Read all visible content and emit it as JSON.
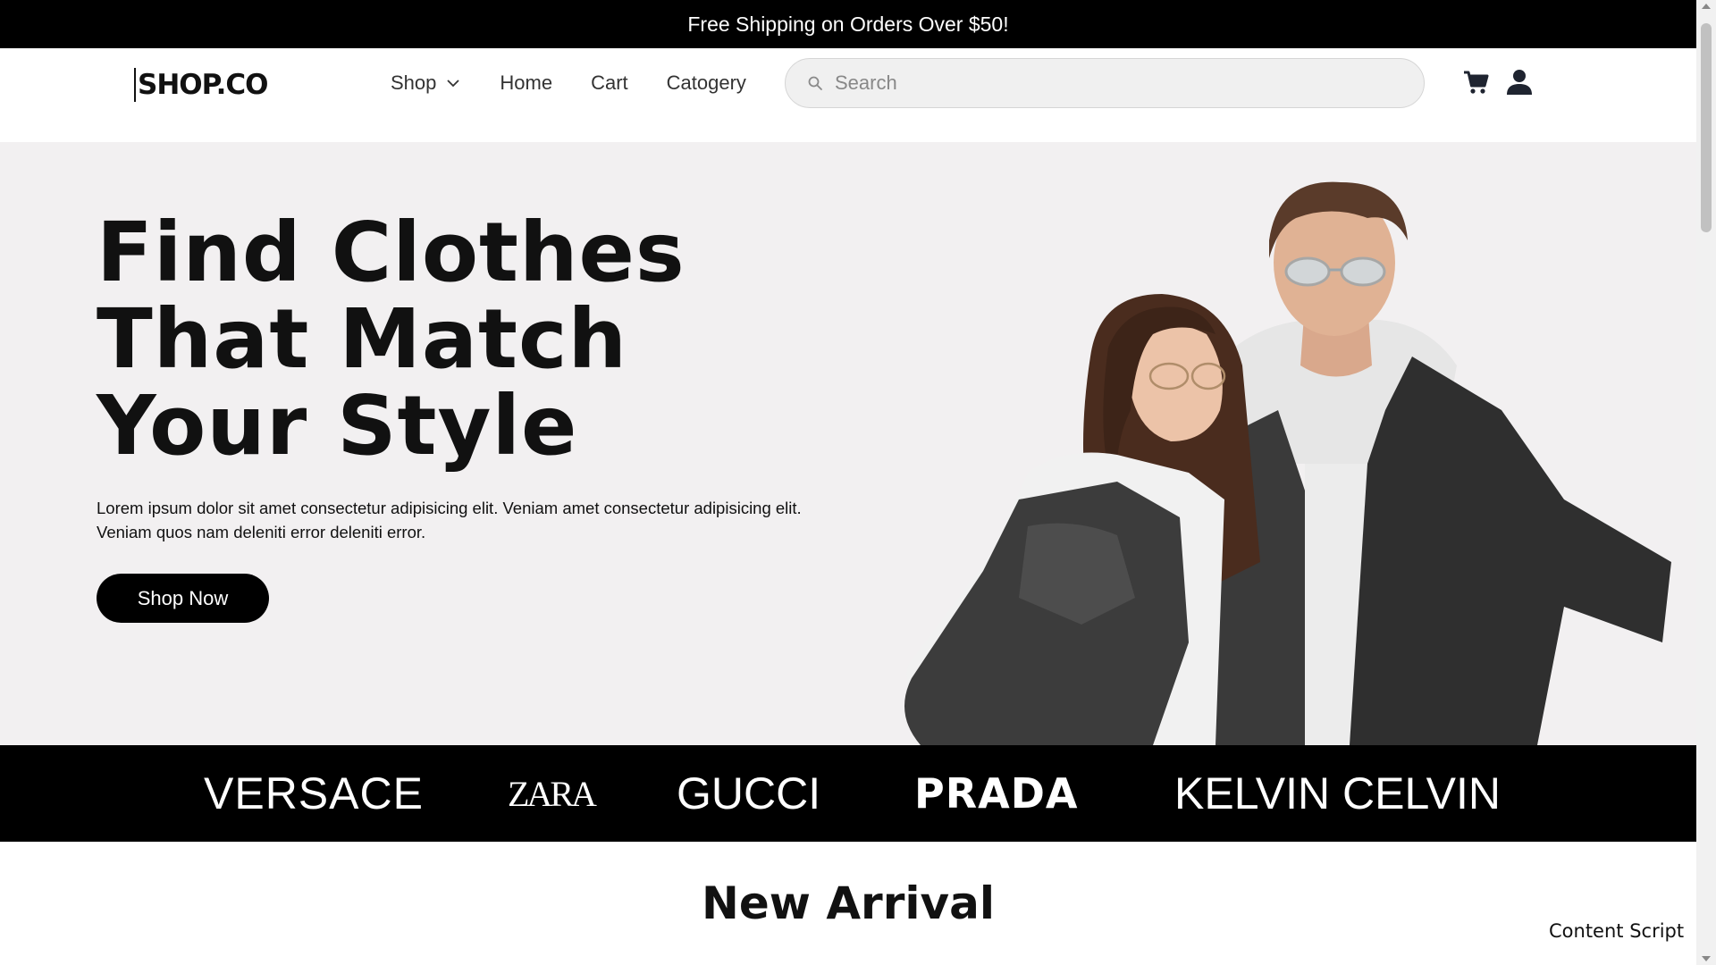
{
  "announcement": {
    "text": "Free Shipping on Orders Over $50!"
  },
  "header": {
    "logo": "SHOP.CO",
    "nav": [
      {
        "label": "Shop",
        "icon": "chevron-down-icon"
      },
      {
        "label": "Home"
      },
      {
        "label": "Cart"
      },
      {
        "label": "Catogery"
      }
    ],
    "search": {
      "placeholder": "Search",
      "value": "",
      "icon": "search-icon"
    },
    "icons": [
      "cart-icon",
      "user-icon"
    ]
  },
  "hero": {
    "title_lines": [
      "Find Clothes",
      "That Match",
      "Your Style"
    ],
    "description": "Lorem ipsum dolor sit amet consectetur adipisicing elit. Veniam amet consectetur adipisicing elit. Veniam quos nam deleniti error deleniti error.",
    "cta_label": "Shop Now",
    "background": "#f2f0f1"
  },
  "brands": [
    "VERSACE",
    "ZARA",
    "GUCCI",
    "PRADA",
    "KELVIN CELVIN"
  ],
  "new_arrival": {
    "title": "New Arrival"
  },
  "overlay": {
    "content_script": "Content Script"
  },
  "colors": {
    "primary": "#000000",
    "text": "#111111",
    "hero_bg": "#f2f0f1",
    "search_bg": "#f0f0f0"
  }
}
